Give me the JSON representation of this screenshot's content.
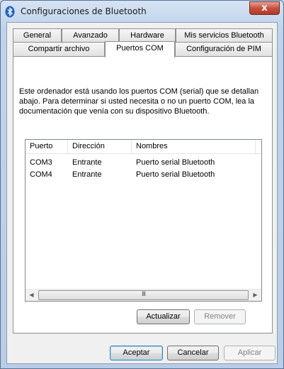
{
  "window": {
    "title": "Configuraciones de Bluetooth",
    "close_glyph": "x"
  },
  "tabs": {
    "row1": [
      "General",
      "Avanzado",
      "Hardware",
      "Mis servicios Bluetooth"
    ],
    "row2": [
      "Compartir archivo",
      "Puertos COM",
      "Configuración de PIM"
    ],
    "active": "Puertos COM"
  },
  "panel": {
    "description": "Este ordenador está usando los puertos COM (serial) que se detallan abajo. Para determinar si usted necesita o no un puerto COM, lea la documentación que venía con su dispositivo Bluetooth."
  },
  "ports": {
    "columns": [
      "Puerto",
      "Dirección",
      "Nombres"
    ],
    "rows": [
      [
        "COM3",
        "Entrante",
        "Puerto serial Bluetooth"
      ],
      [
        "COM4",
        "Entrante",
        "Puerto serial Bluetooth"
      ]
    ]
  },
  "scrollbar": {
    "thumb_grip": "III"
  },
  "buttons": {
    "update": "Actualizar",
    "remove": "Remover",
    "accept": "Aceptar",
    "cancel": "Cancelar",
    "apply": "Aplicar"
  },
  "icons": {
    "window": "bluetooth-icon",
    "close": "close-icon",
    "scroll_left": "arrow-left-icon",
    "scroll_right": "arrow-right-icon"
  },
  "colors": {
    "accent": "#3c7fb1",
    "close_button": "#c7503c",
    "title_bar": "#bfd3ea"
  }
}
